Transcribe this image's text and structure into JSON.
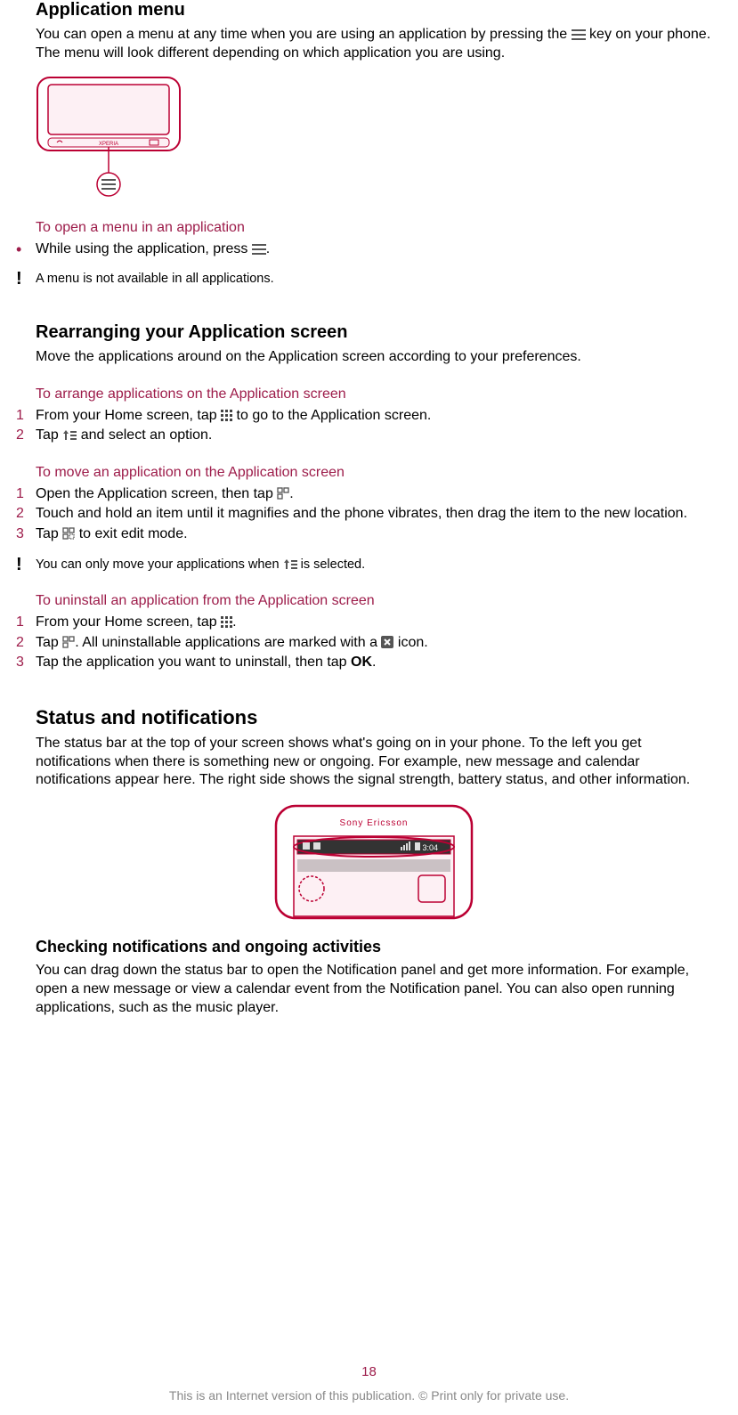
{
  "s1": {
    "heading": "Application menu",
    "p1a": "You can open a menu at any time when you are using an application by pressing the ",
    "p1b": " key on your phone. The menu will look different depending on which application you are using.",
    "task1": "To open a menu in an application",
    "task1_step_a": "While using the application, press ",
    "task1_step_b": ".",
    "note1": "A menu is not available in all applications."
  },
  "s2": {
    "heading": "Rearranging your Application screen",
    "p1": "Move the applications around on the Application screen according to your preferences.",
    "task1": "To arrange applications on the Application screen",
    "task1_s1a": "From your Home screen, tap ",
    "task1_s1b": " to go to the Application screen.",
    "task1_s2a": "Tap ",
    "task1_s2b": " and select an option.",
    "task2": "To move an application on the Application screen",
    "task2_s1a": "Open the Application screen, then tap ",
    "task2_s1b": ".",
    "task2_s2": "Touch and hold an item until it magnifies and the phone vibrates, then drag the item to the new location.",
    "task2_s3a": "Tap ",
    "task2_s3b": " to exit edit mode.",
    "note1a": "You can only move your applications when ",
    "note1b": " is selected.",
    "task3": "To uninstall an application from the Application screen",
    "task3_s1a": "From your Home screen, tap ",
    "task3_s1b": ".",
    "task3_s2a": "Tap ",
    "task3_s2b": ". All uninstallable applications are marked with a ",
    "task3_s2c": " icon.",
    "task3_s3a": "Tap the application you want to uninstall, then tap ",
    "task3_s3_ok": "OK",
    "task3_s3b": "."
  },
  "s3": {
    "heading": "Status and notifications",
    "p1": "The status bar at the top of your screen shows what's going on in your phone. To the left you get notifications when there is something new or ongoing. For example, new message and calendar notifications appear here. The right side shows the signal strength, battery status, and other information.",
    "sub1": "Checking notifications and ongoing activities",
    "p2": "You can drag down the status bar to open the Notification panel and get more information. For example, open a new message or view a calendar event from the Notification panel. You can also open running applications, such as the music player."
  },
  "status_time": "3:04",
  "nums": {
    "n1": "1",
    "n2": "2",
    "n3": "3"
  },
  "page_number": "18",
  "footer": "This is an Internet version of this publication. © Print only for private use."
}
